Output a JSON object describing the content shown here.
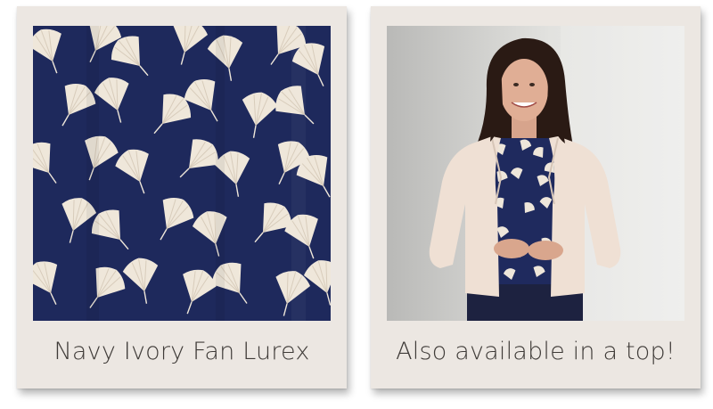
{
  "cards": [
    {
      "caption": "Navy Ivory Fan Lurex",
      "image": "navy-ivory-fan-fabric-swatch",
      "colors": {
        "background": "#1f2a5e",
        "motif": "#efe7da"
      }
    },
    {
      "caption": "Also available in a top!",
      "image": "model-wearing-fan-print-top",
      "colors": {
        "wall": "#dcdcda",
        "jacket": "#efe0d4",
        "top": "#1f2a5e",
        "hair": "#2a1a14"
      }
    }
  ]
}
